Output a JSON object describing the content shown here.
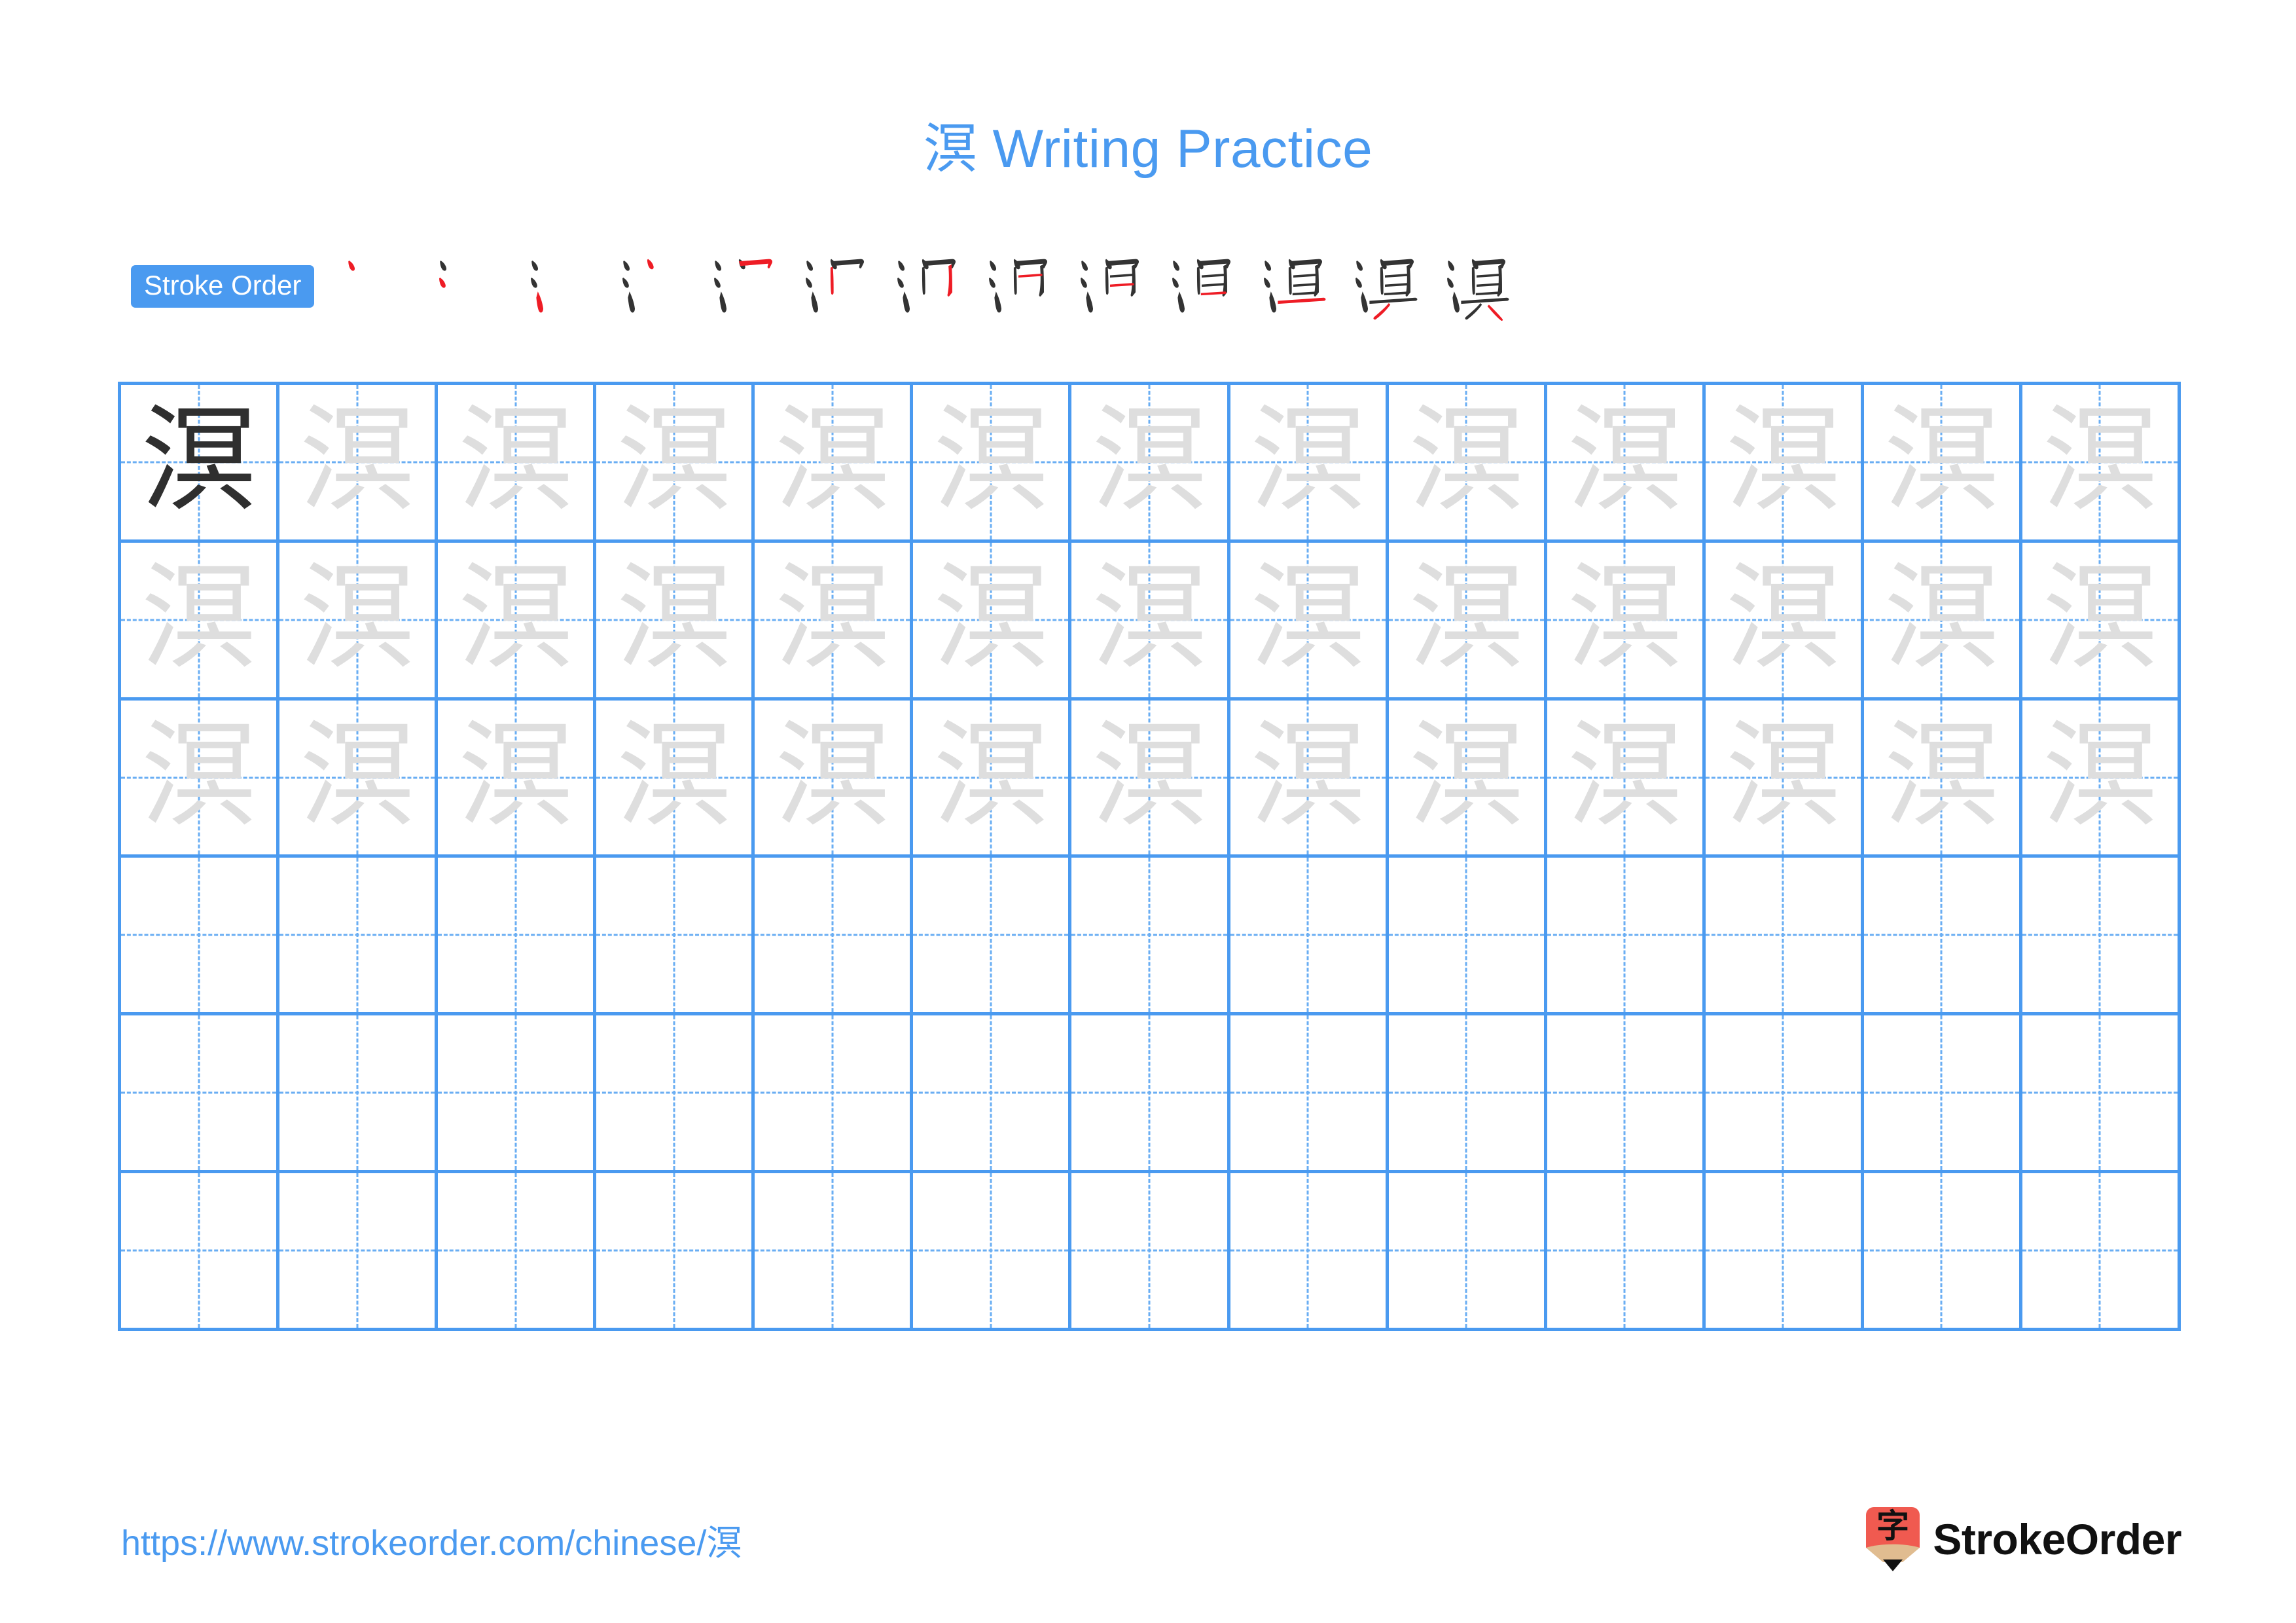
{
  "page": {
    "character": "溟",
    "title": "溟 Writing Practice",
    "accent_color": "#4a9af0",
    "model_char_color": "#2f2f2f",
    "trace_char_color": "#dedede",
    "new_stroke_color": "#ee1c25",
    "existing_stroke_color": "#333333"
  },
  "stroke_order": {
    "badge_label": "Stroke Order",
    "total_strokes": 13,
    "frames": [
      {
        "index": 1,
        "cumulative_strokes": 1,
        "new_stroke": "dot-top-left"
      },
      {
        "index": 2,
        "cumulative_strokes": 2,
        "new_stroke": "dot-middle-left"
      },
      {
        "index": 3,
        "cumulative_strokes": 3,
        "new_stroke": "downward-flick"
      },
      {
        "index": 4,
        "cumulative_strokes": 4,
        "new_stroke": "short-dot-upper-right"
      },
      {
        "index": 5,
        "cumulative_strokes": 5,
        "new_stroke": "horizontal-hook-top"
      },
      {
        "index": 6,
        "cumulative_strokes": 6,
        "new_stroke": "vertical-left"
      },
      {
        "index": 7,
        "cumulative_strokes": 7,
        "new_stroke": "vertical-bend-right"
      },
      {
        "index": 8,
        "cumulative_strokes": 8,
        "new_stroke": "horizontal-inner-1"
      },
      {
        "index": 9,
        "cumulative_strokes": 9,
        "new_stroke": "horizontal-inner-2"
      },
      {
        "index": 10,
        "cumulative_strokes": 10,
        "new_stroke": "horizontal-bottom-box"
      },
      {
        "index": 11,
        "cumulative_strokes": 11,
        "new_stroke": "long-horizontal"
      },
      {
        "index": 12,
        "cumulative_strokes": 12,
        "new_stroke": "left-falling"
      },
      {
        "index": 13,
        "cumulative_strokes": 13,
        "new_stroke": "right-falling"
      }
    ]
  },
  "practice_grid": {
    "columns": 13,
    "rows": 6,
    "row_types": [
      "traced",
      "traced",
      "traced",
      "blank",
      "blank",
      "blank"
    ],
    "first_cell_is_model": true,
    "cell_border_color": "#4a9af0",
    "guide_line_color": "#6aaef3"
  },
  "footer": {
    "url": "https://www.strokeorder.com/chinese/溟",
    "logo_text": "StrokeOrder",
    "logo_glyph": "字",
    "logo_body_color": "#f05a50",
    "logo_wood_color": "#e0bc90",
    "logo_tip_color": "#111111"
  }
}
